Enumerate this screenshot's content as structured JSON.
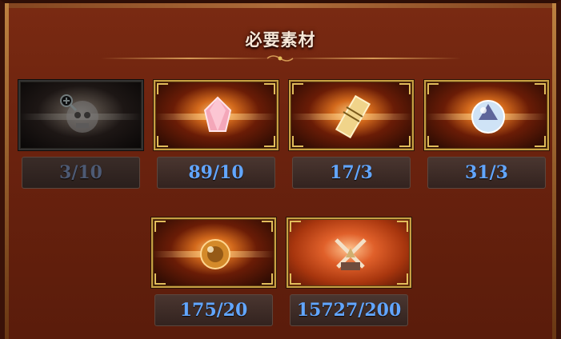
{
  "header": {
    "title": "必要素材"
  },
  "colors": {
    "count_text": "#62a6ff",
    "count_text_disabled": "#4d5a74",
    "frame_gold": "#c7a043",
    "panel_bg": "#6a220e"
  },
  "items": [
    {
      "icon": "skull-orb-icon",
      "count": "3/10",
      "disabled": true,
      "zoom_icon": "zoom-in-icon"
    },
    {
      "icon": "pink-crystal-icon",
      "count": "89/10"
    },
    {
      "icon": "gold-scroll-icon",
      "count": "17/3"
    },
    {
      "icon": "blue-orb-icon",
      "count": "31/3"
    },
    {
      "icon": "amber-orb-icon",
      "count": "175/20"
    },
    {
      "icon": "crossed-swords-icon",
      "count": "15727/200"
    }
  ]
}
